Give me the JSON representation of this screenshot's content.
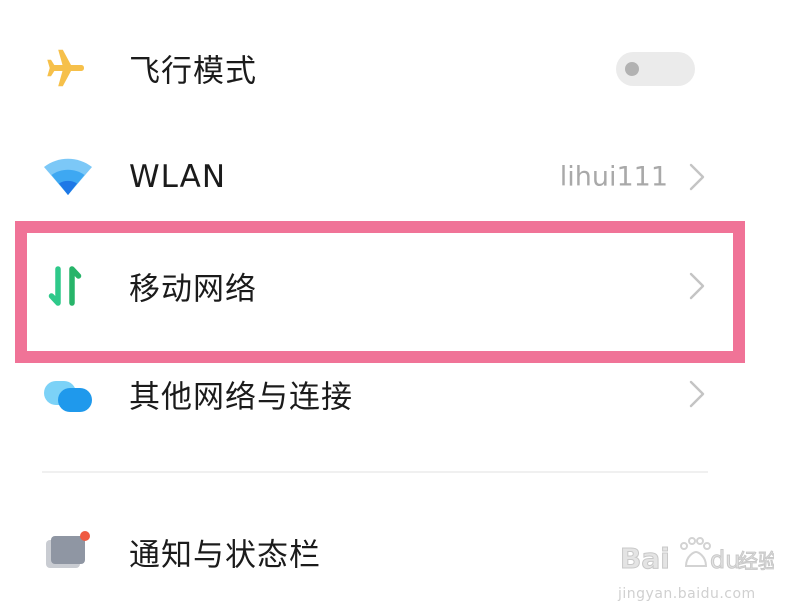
{
  "settings": {
    "airplane_mode": {
      "label": "飞行模式",
      "icon": "airplane-icon",
      "enabled": false
    },
    "wlan": {
      "label": "WLAN",
      "value": "lihui111",
      "icon": "wifi-icon"
    },
    "mobile_network": {
      "label": "移动网络",
      "icon": "mobile-data-icon"
    },
    "other_networks": {
      "label": "其他网络与连接",
      "icon": "connections-icon"
    },
    "notifications": {
      "label": "通知与状态栏",
      "icon": "notification-icon"
    }
  },
  "highlight_color": "#f07397",
  "watermark": {
    "brand": "Baidu经验",
    "url": "jingyan.baidu.com"
  }
}
